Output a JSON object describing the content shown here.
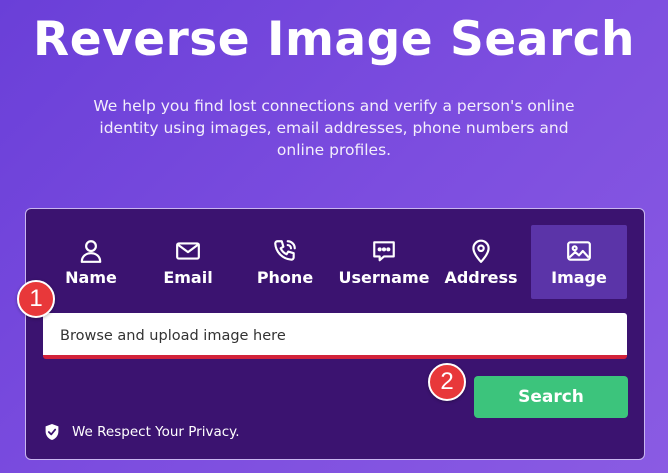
{
  "header": {
    "title": "Reverse Image Search",
    "subtitle": "We help you find lost connections and verify a person's online identity using images, email addresses, phone numbers and online profiles."
  },
  "tabs": [
    {
      "label": "Name",
      "icon": "person-icon",
      "active": false
    },
    {
      "label": "Email",
      "icon": "envelope-icon",
      "active": false
    },
    {
      "label": "Phone",
      "icon": "phone-icon",
      "active": false
    },
    {
      "label": "Username",
      "icon": "chat-icon",
      "active": false
    },
    {
      "label": "Address",
      "icon": "map-pin-icon",
      "active": false
    },
    {
      "label": "Image",
      "icon": "image-icon",
      "active": true
    }
  ],
  "upload": {
    "placeholder": "Browse and upload image here"
  },
  "search_label": "Search",
  "privacy_text": "We Respect Your Privacy.",
  "callouts": [
    "1",
    "2"
  ],
  "colors": {
    "card": "#3b1370",
    "active_tab": "#5b34a8",
    "search_button": "#3cc47c",
    "upload_underline": "#d2223a",
    "callout": "#e8383a"
  }
}
